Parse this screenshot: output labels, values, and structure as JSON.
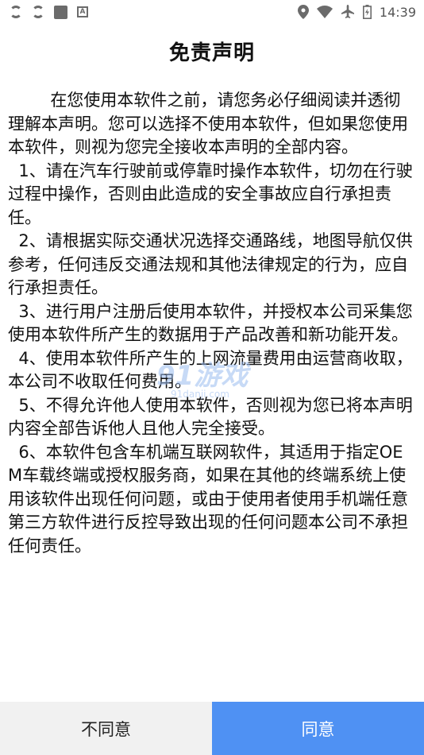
{
  "status_bar": {
    "time": "14:39",
    "left_icons": [
      "sync-icon",
      "sync-icon",
      "square-icon",
      "a-icon"
    ],
    "right_icons": [
      "location-icon",
      "wifi-icon",
      "airplane-icon",
      "battery-icon"
    ]
  },
  "dialog": {
    "title": "免责声明",
    "paragraphs": [
      "        在您使用本软件之前，请您务必仔细阅读并透彻理解本声明。您可以选择不使用本软件，但如果您使用本软件，则视为您完全接收本声明的全部内容。",
      "  1、请在汽车行驶前或停靠时操作本软件，切勿在行驶过程中操作，否则由此造成的安全事故应自行承担责任。",
      "  2、请根据实际交通状况选择交通路线，地图导航仅供参考，任何违反交通法规和其他法律规定的行为，应自行承担责任。",
      "  3、进行用户注册后使用本软件，并授权本公司采集您使用本软件所产生的数据用于产品改善和新功能开发。",
      "  4、使用本软件所产生的上网流量费用由运营商收取，本公司不收取任何费用。",
      "  5、不得允许他人使用本软件，否则视为您已将本声明内容全部告诉他人且他人完全接受。",
      "  6、本软件包含车机端互联网软件，其适用于指定OEM车载终端或授权服务商，如果在其他的终端系统上使用该软件出现任何问题，或由于使用者使用手机端任意第三方软件进行反控导致出现的任何问题本公司不承担任何责任。"
    ]
  },
  "watermark": {
    "main_text": "91游戏",
    "sub_text": "91danji.com"
  },
  "buttons": {
    "disagree_label": "不同意",
    "agree_label": "同意"
  },
  "colors": {
    "agree_bg": "#4f91f3",
    "disagree_bg": "#f1f1f1"
  }
}
